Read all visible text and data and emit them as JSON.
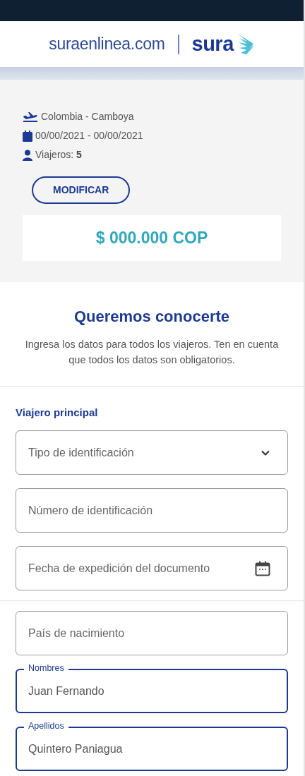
{
  "header": {
    "site": "suraenlinea.com",
    "brand": "sura"
  },
  "summary": {
    "route": "Colombia - Camboya",
    "dates": "00/00/2021 - 00/00/2021",
    "travelers_label": "Viajeros: ",
    "travelers_count": "5",
    "button": "MODIFICAR",
    "price": "$ 000.000 COP"
  },
  "intro": {
    "title": "Queremos conocerte",
    "text": "Ingresa los datos para todos los viajeros. Ten en cuenta que todos los datos son obligatorios."
  },
  "section_title": "Viajero principal",
  "fields": [
    {
      "kind": "select",
      "placeholder": "Tipo de identificación"
    },
    {
      "kind": "text",
      "placeholder": "Número de identificación"
    },
    {
      "kind": "date",
      "placeholder": "Fecha de expedición del documento",
      "divider_after": true
    },
    {
      "kind": "text",
      "placeholder": "País de nacimiento"
    },
    {
      "kind": "text",
      "label": "Nombres",
      "value": "Juan Fernando"
    },
    {
      "kind": "text",
      "label": "Apellidos",
      "value": "Quintero Paniagua"
    }
  ]
}
